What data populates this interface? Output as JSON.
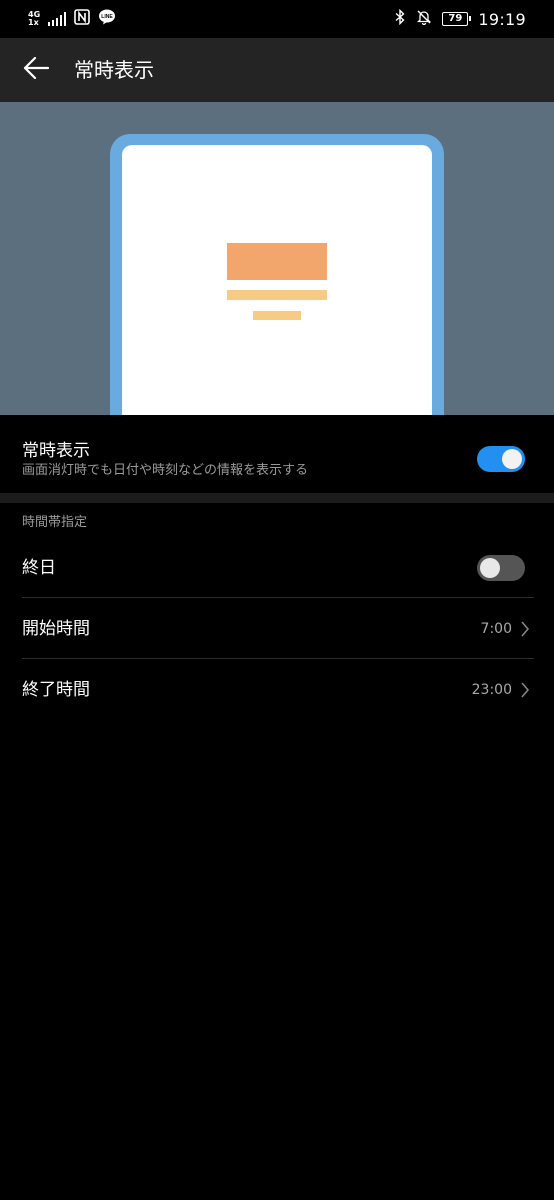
{
  "status_bar": {
    "network_type_top": "4G",
    "network_type_bottom": "1x",
    "battery_level": "79",
    "time": "19:19",
    "icons": [
      "signal-icon",
      "nfc-icon",
      "line-app-icon",
      "bluetooth-icon",
      "mute-bell-icon",
      "battery-icon"
    ]
  },
  "app_bar": {
    "title": "常時表示",
    "back_icon": "back-arrow-icon"
  },
  "preview": {
    "colors": {
      "background": "#5b6f7e",
      "frame": "#6aabdf",
      "screen": "#ffffff",
      "main_bar": "#f3a66b",
      "sub_bar": "#f8cb84"
    }
  },
  "aod_setting": {
    "title": "常時表示",
    "subtitle": "画面消灯時でも日付や時刻などの情報を表示する",
    "enabled": true
  },
  "schedule": {
    "header": "時間帯指定",
    "all_day": {
      "label": "終日",
      "enabled": false
    },
    "start_time": {
      "label": "開始時間",
      "value": "7:00"
    },
    "end_time": {
      "label": "終了時間",
      "value": "23:00"
    }
  },
  "colors": {
    "toggle_on": "#2190f0",
    "toggle_off": "#555555",
    "app_bar": "#242424",
    "background": "#000000"
  }
}
